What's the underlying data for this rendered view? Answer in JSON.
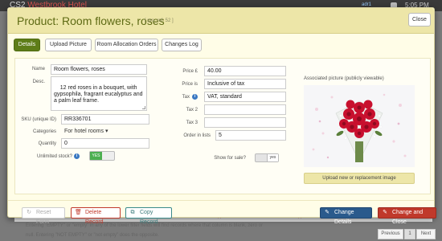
{
  "app": {
    "title_prefix": "CS2",
    "title_name": "Westbrook Hotel",
    "badge": "adr1",
    "time": "5:05 PM"
  },
  "modal": {
    "title": "Product: Room flowers, roses",
    "ref": "[ pro_ref: 52 ]",
    "close_label": "Close",
    "tabs": [
      {
        "label": "Details",
        "active": true
      },
      {
        "label": "Upload Picture",
        "active": false
      },
      {
        "label": "Room Allocation Orders",
        "active": false
      },
      {
        "label": "Changes Log",
        "active": false
      }
    ]
  },
  "form": {
    "name_label": "Name",
    "name_value": "Room flowers, roses",
    "desc_label": "Desc.",
    "desc_value": "12 red roses in a bouquet, with gypsophila, fragrant eucalyptus and a palm leaf frame.",
    "sku_label": "SKU (unique ID)",
    "sku_value": "RR336701",
    "categories_label": "Categories",
    "categories_value": "For hotel rooms ▾",
    "quantity_label": "Quantity",
    "quantity_value": "0",
    "unlimited_label": "Unlimited stock?",
    "unlimited_value": "YES",
    "price_label": "Price £",
    "price_value": "40.00",
    "price_is_label": "Price is",
    "price_is_value": "Inclusive of tax",
    "tax_label": "Tax",
    "tax_value": "VAT, standard",
    "tax2_label": "Tax 2",
    "tax2_value": "",
    "tax3_label": "Tax 3",
    "tax3_value": "",
    "order_label": "Order in lists",
    "order_value": "5",
    "show_sale_label": "Show for sale?",
    "show_sale_value": "yes"
  },
  "picture": {
    "caption": "Associated picture (publicly viewable)",
    "upload_label": "Upload new or replacement image"
  },
  "footer": {
    "reset_label": "Reset Form",
    "delete_label": "Delete Record",
    "copy_label": "Copy Record",
    "change_label": "Change Details",
    "change_close_label": "Change and Close"
  },
  "background": {
    "hint1": "Entering \"EMPTY\" or \"empty\" in any of the lower filter fields will find records where that column is blank, zero or",
    "hint2": "null. Entering \"NOT EMPTY\" or \"not empty\" does the opposite.",
    "prev_label": "Previous",
    "page_label": "1",
    "next_label": "Next"
  },
  "colors": {
    "accent": "#5e7d18",
    "header": "#ede6a8",
    "primary": "#2a5a8c",
    "danger": "#c0392b"
  }
}
